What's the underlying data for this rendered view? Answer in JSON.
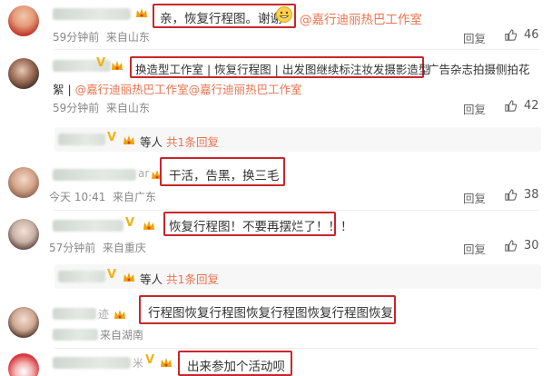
{
  "comments": [
    {
      "time": "59分钟前",
      "location": "来自山东",
      "reply": "回复",
      "likes": "46",
      "text": "亲，恢复行程图。谢谢",
      "mention": "@嘉行迪丽热巴工作室"
    },
    {
      "time": "59分钟前",
      "location": "来自山东",
      "reply": "回复",
      "likes": "42",
      "box_text": "换造型工作室 | 恢复行程图 | 出发图继续标注妆发摄影造型",
      "tail_text": "广告杂志拍摄侧拍花",
      "line2_prefix": "絮 | ",
      "line2_mentions": "@嘉行迪丽热巴工作室@嘉行迪丽热巴工作室"
    },
    {
      "time": "今天 10:41",
      "location": "来自广东",
      "reply": "回复",
      "likes": "38",
      "text": "干活，告黑，换三毛",
      "name_tail": "ar"
    },
    {
      "time": "57分钟前",
      "location": "来自重庆",
      "reply": "回复",
      "likes": "30",
      "text": "恢复行程图！不要再摆烂了！！！"
    },
    {
      "time": "",
      "location": "来自湖南",
      "reply": "",
      "likes": "",
      "text": "行程图恢复行程图恢复行程图恢复行程图恢复",
      "name_tail": "迹"
    },
    {
      "text": "出来参加个活动呗",
      "name_tail": "米"
    }
  ],
  "subreplies": [
    {
      "who": "等人",
      "link": "共1条回复"
    },
    {
      "who": "等人",
      "link": "共1条回复"
    }
  ],
  "colors": {
    "highlight_box": "#c8262b",
    "link": "#eb7350",
    "meta": "#888888"
  },
  "icons": [
    "like-icon",
    "vip-badge-icon",
    "crown-icon",
    "emoji-grin-icon"
  ]
}
